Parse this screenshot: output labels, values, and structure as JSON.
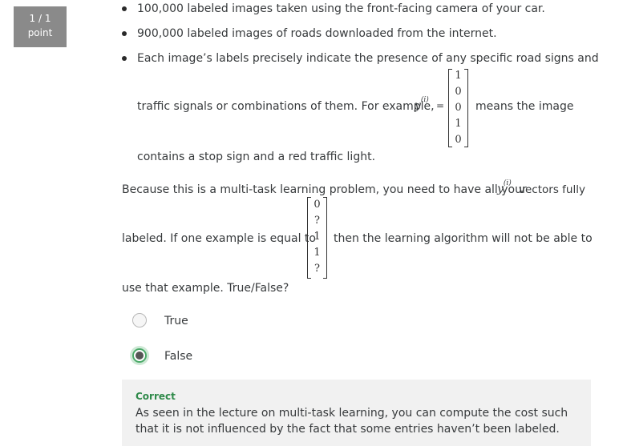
{
  "score": {
    "fraction": "1 / 1",
    "unit": "point"
  },
  "bullets": [
    {
      "text": "100,000 labeled images taken using the front-facing camera of your car."
    },
    {
      "text": "900,000 labeled images of roads downloaded from the internet."
    },
    {
      "text_line1": "Each image’s labels precisely indicate the presence of any specific road signs and",
      "text_line2_before": "traffic signals or combinations of them. For example,",
      "var": "y",
      "superscript": "(i)",
      "equals": "=",
      "matrix": [
        "1",
        "0",
        "0",
        "1",
        "0"
      ],
      "text_line2_after": "means the image",
      "text_line3": "contains a stop sign and a red traffic light."
    }
  ],
  "question": {
    "line1_before": "Because this is a multi-task learning problem, you need to have all your",
    "var": "y",
    "superscript": "(i)",
    "line1_after": "vectors fully",
    "line2_before": "labeled. If one example is equal to",
    "matrix": [
      "0",
      "?",
      "1",
      "1",
      "?"
    ],
    "line2_after": "then the learning algorithm will not be able to",
    "line3": "use that example. True/False?"
  },
  "options": [
    {
      "label": "True",
      "selected": false
    },
    {
      "label": "False",
      "selected": true
    }
  ],
  "feedback": {
    "status": "Correct",
    "message": "As seen in the lecture on multi-task learning, you can compute the cost such that it is not influenced by the fact that some entries haven’t been labeled.",
    "color": "#2f8a4a"
  }
}
